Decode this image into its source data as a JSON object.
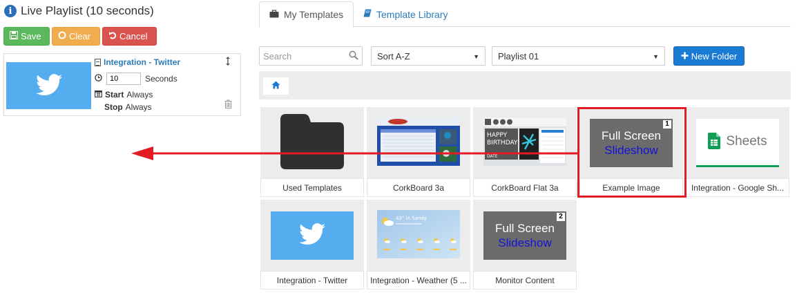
{
  "header": {
    "title": "Live Playlist (10 seconds)"
  },
  "actions": {
    "save": "Save",
    "clear": "Clear",
    "cancel": "Cancel"
  },
  "playlist_item": {
    "name": "Integration - Twitter",
    "duration": "10",
    "duration_unit": "Seconds",
    "start_label": "Start",
    "start_value": "Always",
    "stop_label": "Stop",
    "stop_value": "Always"
  },
  "tabs": {
    "my_templates": "My Templates",
    "template_library": "Template Library"
  },
  "toolbar": {
    "search_placeholder": "Search",
    "sort_value": "Sort A-Z",
    "playlist_value": "Playlist 01",
    "new_folder": "New Folder"
  },
  "templates": {
    "used": "Used Templates",
    "corkboard": "CorkBoard 3a",
    "corkboard_flat": "CorkBoard Flat 3a",
    "example_image": "Example Image",
    "google_sheets": "Integration - Google Sh...",
    "twitter": "Integration - Twitter",
    "weather": "Integration - Weather (5 ...",
    "monitor": "Monitor Content"
  },
  "thumbs": {
    "fullscreen_line1": "Full Screen",
    "fullscreen_line2": "Slideshow",
    "badge_1": "1",
    "badge_2": "2",
    "sheets_text": "Sheets",
    "birthday_line1": "HAPPY",
    "birthday_line2": "BIRTHDAY!",
    "birthday_line3": "DATE",
    "weather_text": "42° in Sandy"
  },
  "colors": {
    "save": "#5cb85c",
    "clear": "#f0ad4e",
    "cancel": "#d9534f",
    "primary": "#1a7bd4",
    "twitter": "#55acee",
    "highlight": "#e31b23"
  }
}
